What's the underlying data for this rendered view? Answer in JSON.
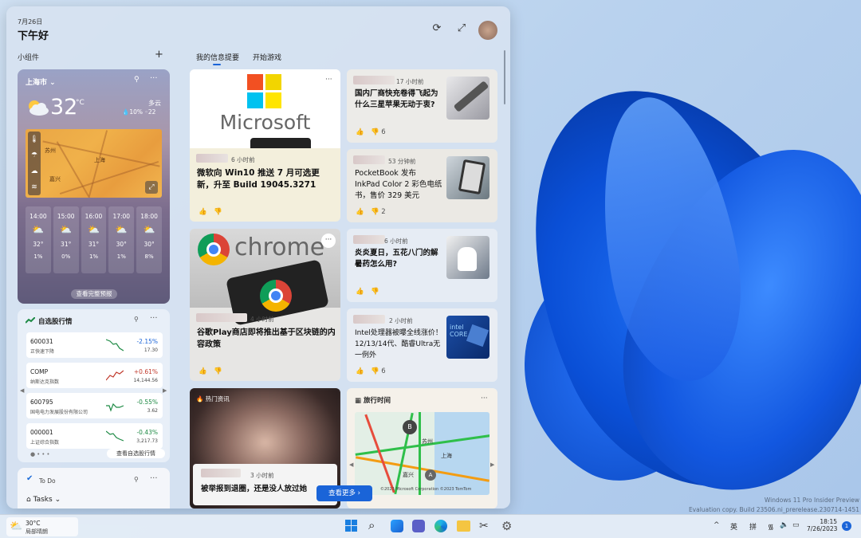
{
  "header": {
    "date": "7月26日",
    "greeting": "下午好",
    "refresh": "⟳",
    "expand": "⤢"
  },
  "widgets_label": "小组件",
  "add_widget": "+",
  "tabs": [
    {
      "label": "我的信息提要"
    },
    {
      "label": "开始游戏"
    }
  ],
  "weather": {
    "city": "上海市",
    "temp": "32",
    "unit": "°C",
    "condition": "多云",
    "precip": "10%",
    "humidity": "22",
    "map_labels": [
      "苏州",
      "上海",
      "嘉兴"
    ],
    "hours": [
      {
        "time": "14:00",
        "temp": "32°",
        "precip": "1%"
      },
      {
        "time": "15:00",
        "temp": "31°",
        "precip": "0%"
      },
      {
        "time": "16:00",
        "temp": "31°",
        "precip": "1%"
      },
      {
        "time": "17:00",
        "temp": "30°",
        "precip": "1%"
      },
      {
        "time": "18:00",
        "temp": "30°",
        "precip": "8%"
      }
    ],
    "full_forecast": "查看完整预报"
  },
  "stocks": {
    "title": "自选股行情",
    "rows": [
      {
        "code": "600031",
        "name": "正快速下降",
        "change": "-2.15%",
        "price": "17.30",
        "color": "#c0392b"
      },
      {
        "code": "COMP",
        "name": "纳斯达克指数",
        "change": "+0.61%",
        "price": "14,144.56",
        "color": "#c0392b"
      },
      {
        "code": "600795",
        "name": "国电电力发展股份有限公司",
        "change": "-0.55%",
        "price": "3.62",
        "color": "#1e8a45"
      },
      {
        "code": "000001",
        "name": "上证综合指数",
        "change": "-0.43%",
        "price": "3,217.73",
        "color": "#1e8a45"
      }
    ],
    "more": "查看自选股行情"
  },
  "todo": {
    "title": "To Do",
    "tasks": "Tasks"
  },
  "feed": {
    "c1": {
      "logo": "Microsoft",
      "time": "6 小时前",
      "headline": "微软向 Win10 推送 7 月可选更新，升至 Build 19045.3271"
    },
    "c2": {
      "time": "17 小时前",
      "headline": "国内厂商快充卷得飞起为什么三星苹果无动于衷?",
      "dislikes": "6"
    },
    "c3": {
      "time": "53 分钟前",
      "headline": "PocketBook 发布 InkPad Color 2 彩色电纸书，售价 329 美元",
      "dislikes": "2"
    },
    "c4": {
      "logo": "chrome",
      "time": "4 小时前",
      "headline": "谷歌Play商店即将推出基于区块链的内容政策"
    },
    "c5": {
      "time": "6 小时前",
      "headline": "炎炎夏日，五花八门的解暑药怎么用?"
    },
    "c6": {
      "time": "2 小时前",
      "headline": "Intel处理器被曝全线涨价！12/13/14代、酷睿Ultra无一例外",
      "dislikes": "6",
      "thumb_text": "intel CORE"
    },
    "c7": {
      "tag": "热门资讯",
      "time": "3 小时前",
      "headline": "被举报到退圈，还是没人放过她"
    },
    "c8": {
      "title": "旅行时间",
      "map_labels": [
        "苏州",
        "上海",
        "嘉兴"
      ],
      "attribution": "©2023 Microsoft Corporation ©2023 TomTom"
    },
    "see_more": "查看更多"
  },
  "taskbar": {
    "weather_temp": "30°C",
    "weather_cond": "局部晴朗",
    "ime1": "英",
    "ime2": "拼",
    "time": "18:15",
    "date": "7/26/2023",
    "notif": "1"
  },
  "watermark": {
    "line1": "Windows 11 Pro Insider Preview",
    "line2": "Evaluation copy. Build 23506.ni_prerelease.230714-1451"
  },
  "colors": {
    "accent": "#1a64d8",
    "neg": "#1e8a45",
    "pos": "#c0392b"
  }
}
